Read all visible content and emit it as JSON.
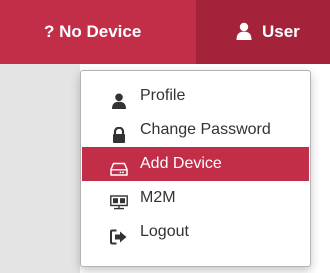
{
  "navbar": {
    "device_label": "? No Device",
    "user_label": "User",
    "user_icon": "user-icon"
  },
  "menu": {
    "items": [
      {
        "label": "Profile",
        "icon": "user-icon",
        "active": false
      },
      {
        "label": "Change Password",
        "icon": "lock-icon",
        "active": false
      },
      {
        "label": "Add Device",
        "icon": "hard-drive-icon",
        "active": true
      },
      {
        "label": "M2M",
        "icon": "network-icon",
        "active": false
      },
      {
        "label": "Logout",
        "icon": "sign-out-icon",
        "active": false
      }
    ]
  },
  "colors": {
    "brand": "#c22d48",
    "brand_dark": "#a5223b",
    "text": "#333333"
  }
}
